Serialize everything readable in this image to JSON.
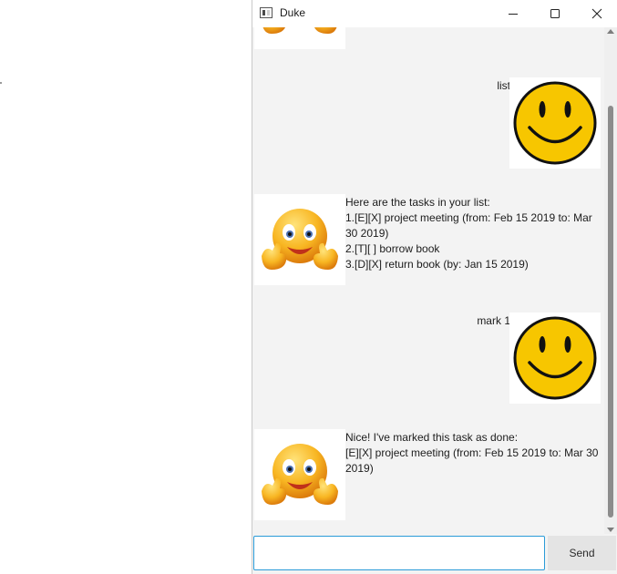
{
  "window": {
    "title": "Duke",
    "controls": [
      "minimize-icon",
      "maximize-icon",
      "close-icon"
    ]
  },
  "dialog": [
    {
      "speaker": "duke",
      "text": ""
    },
    {
      "speaker": "user",
      "text": "list"
    },
    {
      "speaker": "duke",
      "text": "Here are the tasks in your list:\n1.[E][X] project meeting (from: Feb 15 2019 to: Mar 30 2019)\n2.[T][ ] borrow book\n3.[D][X] return book (by: Jan 15 2019)"
    },
    {
      "speaker": "user",
      "text": "mark 1"
    },
    {
      "speaker": "duke",
      "text": "Nice! I've marked this task as done:\n[E][X] project meeting (from: Feb 15 2019 to: Mar 30 2019)"
    }
  ],
  "input": {
    "value": "",
    "placeholder": ""
  },
  "send": {
    "label": "Send"
  },
  "colors": {
    "accent": "#2a9bd8",
    "smiley_yellow": "#f7c600",
    "background": "#f3f3f3"
  }
}
